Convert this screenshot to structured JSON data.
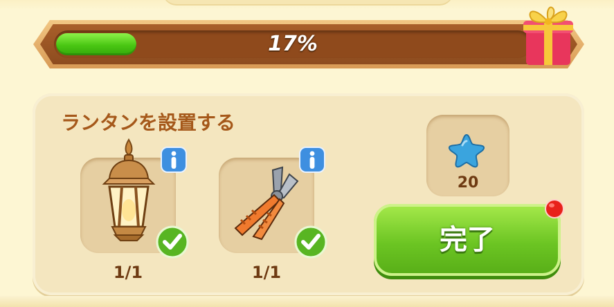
{
  "progress": {
    "label": "17%",
    "value": 0.17
  },
  "task": {
    "title": "ランタンを設置する",
    "items": [
      {
        "icon": "lantern-icon",
        "count": "1/1",
        "complete": true
      },
      {
        "icon": "pliers-icon",
        "count": "1/1",
        "complete": true
      }
    ]
  },
  "reward": {
    "icon": "blue-star-icon",
    "amount": "20"
  },
  "complete_button": {
    "label": "完了"
  },
  "colors": {
    "progress_fill": "#4ac713",
    "title_text": "#a5581a",
    "button_green": "#6cc523",
    "notify_red": "#e8221a"
  }
}
